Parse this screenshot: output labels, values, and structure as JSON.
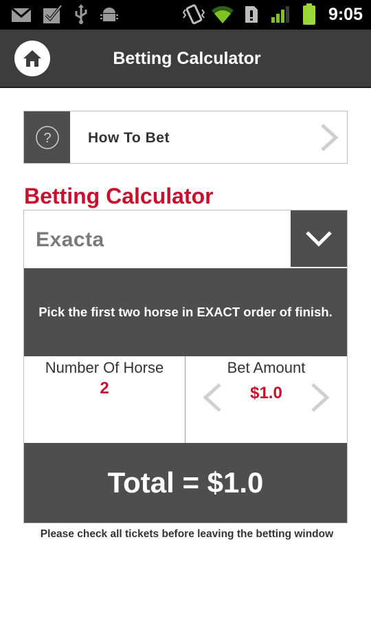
{
  "status_bar": {
    "time": "9:05",
    "icons": [
      "gmail-icon",
      "task-check-icon",
      "usb-icon",
      "android-debug-icon",
      "vibrate-icon",
      "wifi-icon",
      "sim-icon",
      "signal-icon",
      "battery-icon"
    ]
  },
  "header": {
    "title": "Betting Calculator",
    "home_icon": "home-icon"
  },
  "how_to_bet": {
    "label": "How To Bet",
    "icon": "question-icon",
    "chevron": "chevron-right-icon"
  },
  "calculator": {
    "heading": "Betting Calculator",
    "bet_type": "Exacta",
    "description": "Pick the first two horse in EXACT order of finish.",
    "number_of_horse_label": "Number Of Horse",
    "number_of_horse_value": "2",
    "bet_amount_label": "Bet Amount",
    "bet_amount_value": "$1.0",
    "total": "Total = $1.0"
  },
  "footer": {
    "note": "Please check all tickets before leaving the betting window"
  },
  "colors": {
    "accent_red": "#c8102e",
    "dark_panel": "#4e4e4e",
    "title_bar": "#3d3d3d"
  }
}
